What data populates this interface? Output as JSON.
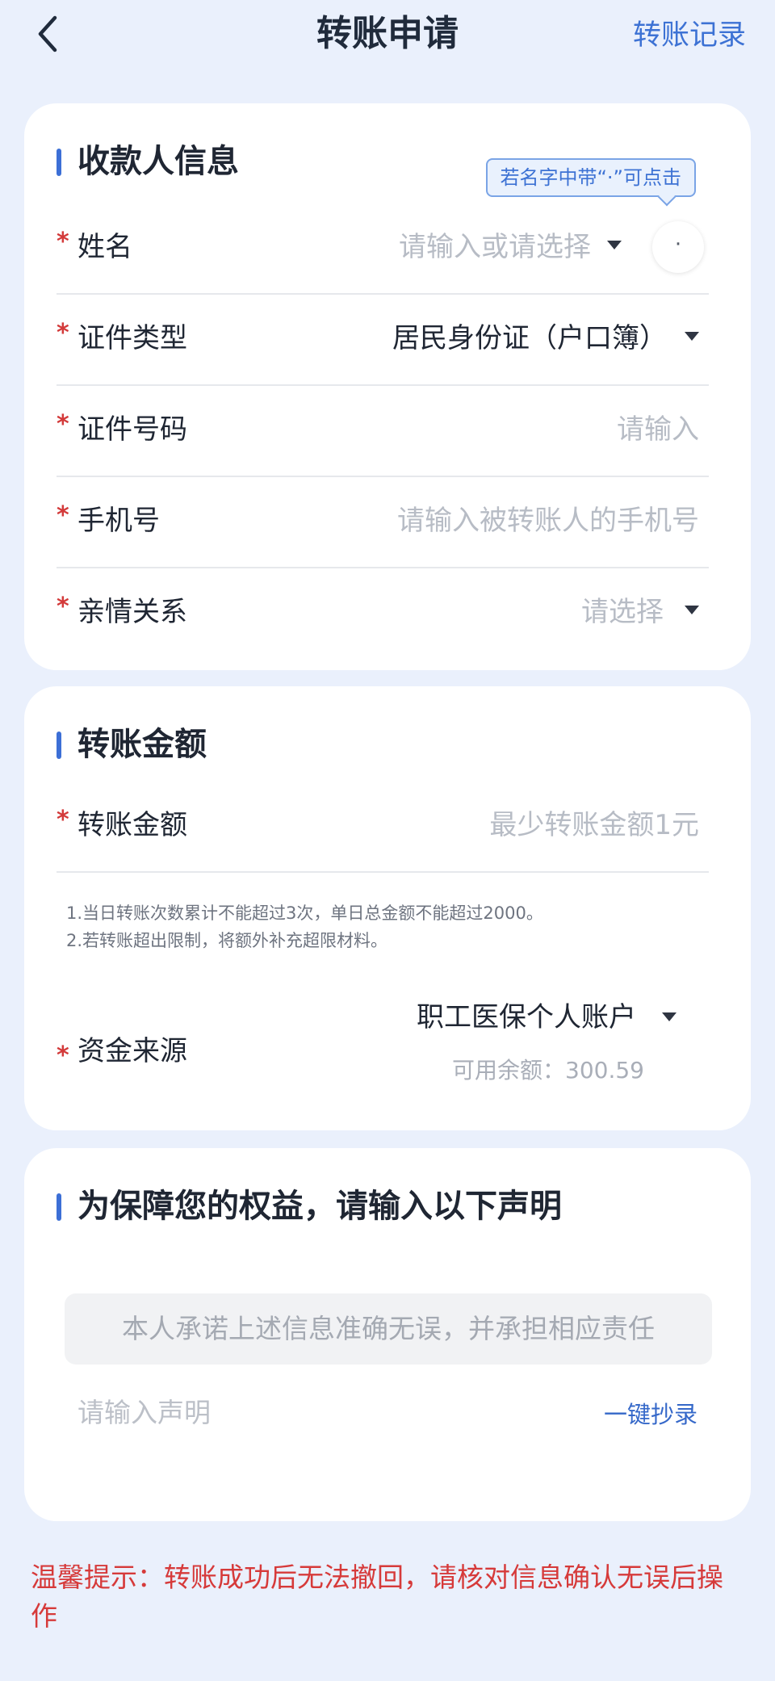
{
  "header": {
    "title": "转账申请",
    "record_link": "转账记录"
  },
  "payee": {
    "section_title": "收款人信息",
    "tooltip": "若名字中带“·”可点击",
    "dot_button": "·",
    "name": {
      "label": "姓名",
      "placeholder": "请输入或请选择"
    },
    "id_type": {
      "label": "证件类型",
      "value": "居民身份证（户口簿）"
    },
    "id_number": {
      "label": "证件号码",
      "placeholder": "请输入"
    },
    "phone": {
      "label": "手机号",
      "placeholder": "请输入被转账人的手机号"
    },
    "relation": {
      "label": "亲情关系",
      "placeholder": "请选择"
    }
  },
  "amount": {
    "section_title": "转账金额",
    "amount_field": {
      "label": "转账金额",
      "placeholder": "最少转账金额1元"
    },
    "notes": [
      "1.当日转账次数累计不能超过3次，单日总金额不能超过2000。",
      "2.若转账超出限制，将额外补充超限材料。"
    ],
    "source": {
      "label": "资金来源",
      "value": "职工医保个人账户",
      "balance": "可用余额：300.59"
    }
  },
  "statement": {
    "section_title": "为保障您的权益，请输入以下声明",
    "text": "本人承诺上述信息准确无误，并承担相应责任",
    "input_placeholder": "请输入声明",
    "copy_button": "一键抄录"
  },
  "warm_tip": "温馨提示：转账成功后无法撤回，请核对信息确认无误后操作",
  "required_mark": "*",
  "colors": {
    "accent": "#3c6fd6",
    "link": "#3d72d4",
    "required": "#d33a3a",
    "warning": "#d63a3a",
    "background": "#eaf0fc"
  }
}
